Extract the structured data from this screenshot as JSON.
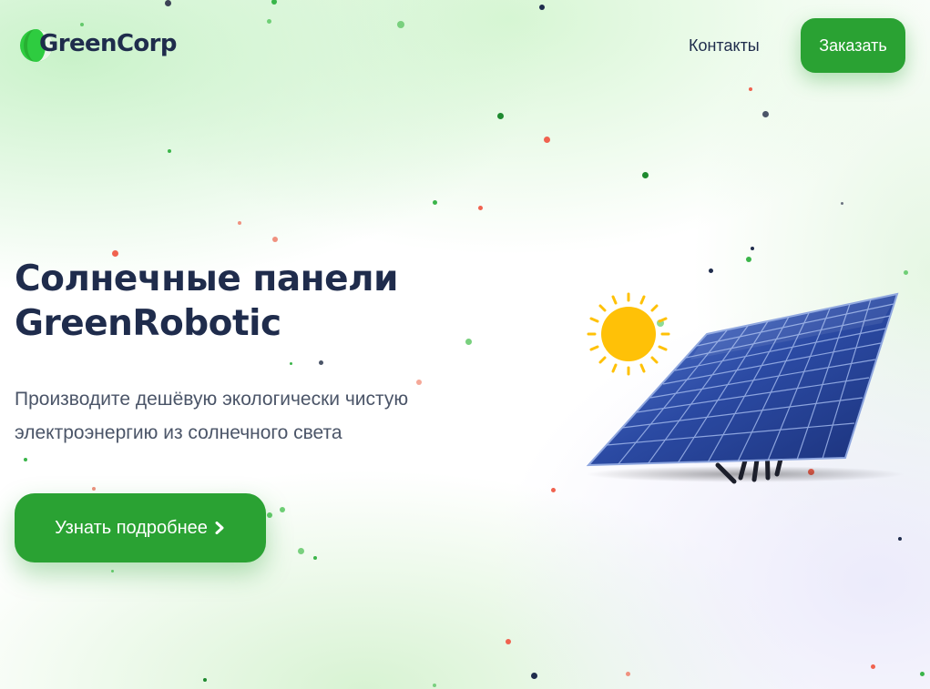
{
  "brand": {
    "name": "GreenCorp",
    "logo_icon": "leaf-circle-icon",
    "color": "#2aa233",
    "text_color": "#1f2c4c"
  },
  "nav": {
    "contacts_label": "Контакты",
    "order_label": "Заказать"
  },
  "hero": {
    "title_line1": "Солнечные панели",
    "title_line2": "GreenRobotic",
    "subtitle_line1": "Производите дешёвую экологически чистую",
    "subtitle_line2": "электроэнергию из солнечного света",
    "cta_label": "Узнать подробнее",
    "cta_icon": "chevron-right-icon",
    "illustration": "solar-panel-with-sun-illustration"
  }
}
